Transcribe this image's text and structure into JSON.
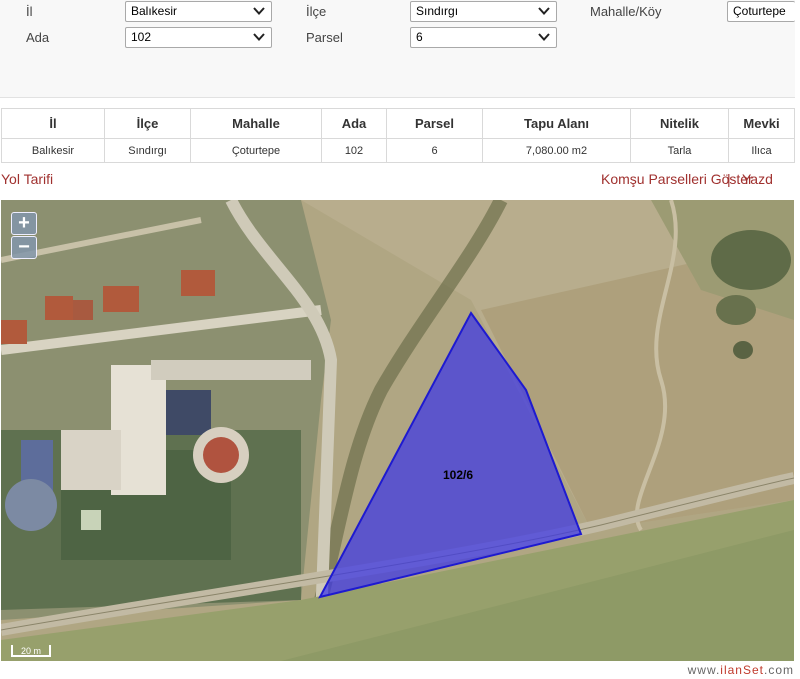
{
  "filters": {
    "il": {
      "label": "İl",
      "value": "Balıkesir"
    },
    "ilce": {
      "label": "İlçe",
      "value": "Sındırgı"
    },
    "mahalle": {
      "label": "Mahalle/Köy",
      "value": "Çoturtepe"
    },
    "ada": {
      "label": "Ada",
      "value": "102"
    },
    "parsel": {
      "label": "Parsel",
      "value": "6"
    }
  },
  "table": {
    "headers": [
      "İl",
      "İlçe",
      "Mahalle",
      "Ada",
      "Parsel",
      "Tapu Alanı",
      "Nitelik",
      "Mevki"
    ],
    "row": [
      "Balıkesir",
      "Sındırgı",
      "Çoturtepe",
      "102",
      "6",
      "7,080.00 m2",
      "Tarla",
      "Ilıca"
    ]
  },
  "links": {
    "directions": "Yol Tarifi",
    "neighbors": "Komşu Parselleri Göster",
    "separator": "|",
    "print": "Yazd"
  },
  "map": {
    "zoom_in": "+",
    "zoom_out": "−",
    "parcel_label": "102/6",
    "scale_label": "20 m",
    "parcel_fill": "#3b36e8",
    "parcel_stroke": "#1e1ad0"
  },
  "watermark": {
    "prefix": "www.",
    "brand": "ilanSet",
    "suffix": ".com"
  }
}
